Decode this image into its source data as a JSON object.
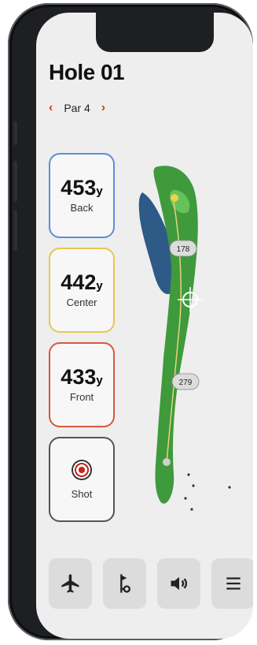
{
  "header": {
    "hole_title": "Hole 01",
    "par_label": "Par 4",
    "prev_symbol": "‹",
    "next_symbol": "›"
  },
  "distances": [
    {
      "value": "453",
      "unit": "y",
      "label": "Back",
      "color": "#5b8fd8"
    },
    {
      "value": "442",
      "unit": "y",
      "label": "Center",
      "color": "#e6c84c"
    },
    {
      "value": "433",
      "unit": "y",
      "label": "Front",
      "color": "#d9573f"
    }
  ],
  "shot": {
    "label": "Shot",
    "icon": "target-icon"
  },
  "map": {
    "marker_top": "178",
    "marker_bottom": "279",
    "fairway_color": "#3f9a3c",
    "water_color": "#2d5a86"
  },
  "toolbar": {
    "icons": [
      "airplane-icon",
      "tee-icon",
      "speaker-icon",
      "menu-icon"
    ]
  },
  "colors": {
    "accent": "#d8352a"
  }
}
